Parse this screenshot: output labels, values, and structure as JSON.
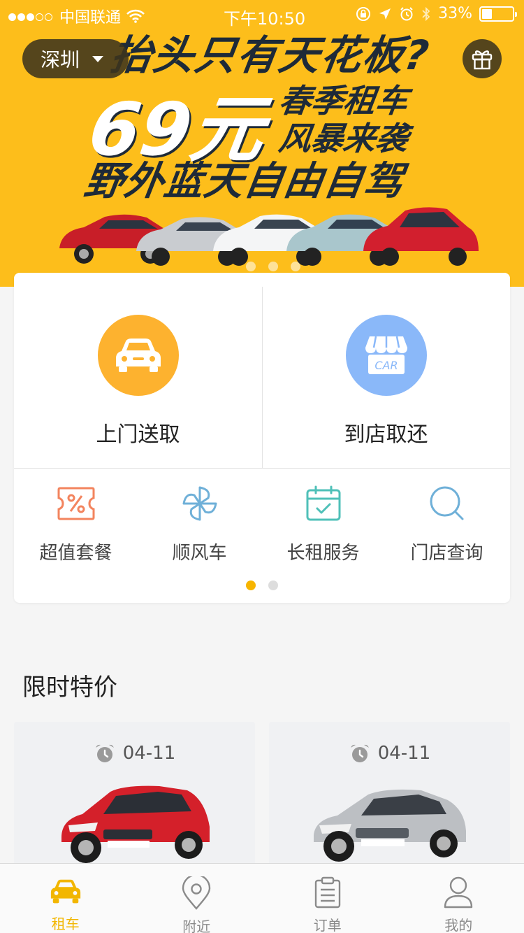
{
  "status_bar": {
    "carrier": "中国联通",
    "time": "下午10:50",
    "battery": "33%",
    "battery_level": 0.33
  },
  "banner": {
    "city": "深圳",
    "promo_line1": "抬头只有天花板?",
    "promo_price": "69元",
    "promo_line2": "春季租车",
    "promo_line3": "风暴来袭",
    "promo_line4": "野外蓝天自由自驾",
    "dots_count": 3,
    "colors": {
      "background": "#fdbe1b",
      "promo_text": "#1e2a38"
    }
  },
  "services": {
    "main": [
      {
        "label": "上门送取",
        "icon": "car-icon",
        "color": "#fdb22f"
      },
      {
        "label": "到店取还",
        "icon": "car-store-icon",
        "color": "#8ab8f9",
        "store_text": "CAR"
      }
    ],
    "sub": [
      {
        "label": "超值套餐",
        "icon": "discount-coupon-icon",
        "color": "#f3845e"
      },
      {
        "label": "顺风车",
        "icon": "pinwheel-icon",
        "color": "#6fb0d8"
      },
      {
        "label": "长租服务",
        "icon": "calendar-check-icon",
        "color": "#4fc0b8"
      },
      {
        "label": "门店查询",
        "icon": "search-icon",
        "color": "#6fb0d8"
      }
    ],
    "page_dots": {
      "count": 2,
      "active": 0
    }
  },
  "limited_offers": {
    "title": "限时特价",
    "items": [
      {
        "date": "04-11",
        "car_color": "#d4202a"
      },
      {
        "date": "04-11",
        "car_color": "#b9bcc0"
      }
    ]
  },
  "tabbar": {
    "tabs": [
      {
        "label": "租车",
        "icon": "car-icon",
        "active": true
      },
      {
        "label": "附近",
        "icon": "location-pin-icon",
        "active": false
      },
      {
        "label": "订单",
        "icon": "clipboard-icon",
        "active": false
      },
      {
        "label": "我的",
        "icon": "user-icon",
        "active": false
      }
    ],
    "colors": {
      "active": "#f2b600",
      "inactive": "#8a8a8a"
    }
  }
}
